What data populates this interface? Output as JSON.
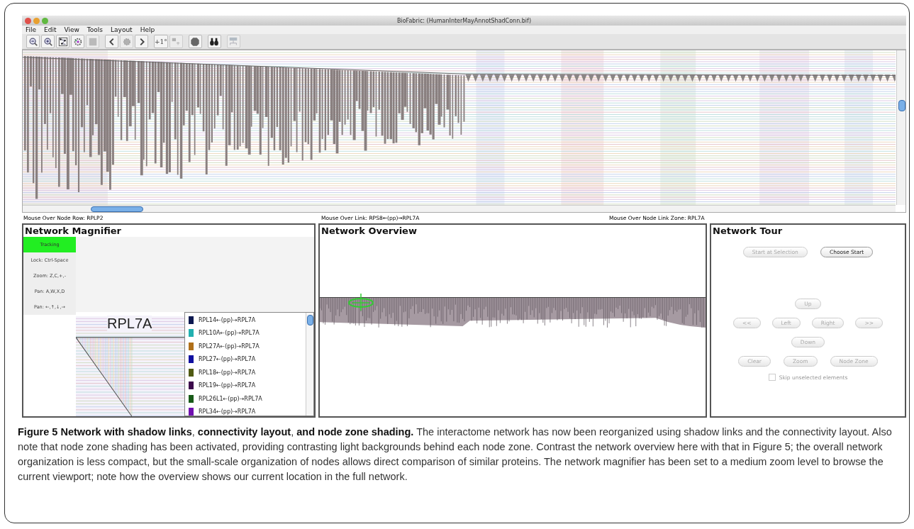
{
  "window": {
    "title": "BioFabric: (HumanInterMayAnnotShadConn.bif)"
  },
  "menu": [
    "File",
    "Edit",
    "View",
    "Tools",
    "Layout",
    "Help"
  ],
  "toolbar": [
    {
      "kind": "icon",
      "disabled": false
    },
    {
      "kind": "icon",
      "disabled": false
    },
    {
      "kind": "icon",
      "disabled": false
    },
    {
      "kind": "icon",
      "disabled": false
    },
    {
      "kind": "icon",
      "disabled": true
    },
    {
      "kind": "icon",
      "disabled": false
    },
    {
      "kind": "icon",
      "disabled": true
    },
    {
      "kind": "icon",
      "disabled": false
    },
    {
      "kind": "text",
      "label": "+1°",
      "disabled": false
    },
    {
      "kind": "icon",
      "disabled": true
    },
    {
      "kind": "icon",
      "disabled": false
    },
    {
      "kind": "icon",
      "disabled": false
    },
    {
      "kind": "icon",
      "disabled": true
    }
  ],
  "status_bar": [
    "Mouse Over Node Row: RPLP2",
    "Mouse Over Link: RPS8←(pp)→RPL7A",
    "Mouse Over Node Link Zone: RPL7A"
  ],
  "magnifier": {
    "title": "Network Magnifier",
    "controls": [
      {
        "label": "Tracking",
        "selected": true
      },
      {
        "label": "Lock: Ctrl-Space",
        "selected": false
      },
      {
        "label": "Zoom: Z,C,+,-",
        "selected": false
      },
      {
        "label": "Pan: A,W,X,D",
        "selected": false
      },
      {
        "label": "Pan: ←,↑,↓,→",
        "selected": false
      }
    ],
    "node_label": "RPL7A",
    "links": [
      {
        "label": "RPL14←(pp)→RPL7A",
        "color": "#0c1850"
      },
      {
        "label": "RPL10A←(pp)→RPL7A",
        "color": "#22b0b0"
      },
      {
        "label": "RPL27A←(pp)→RPL7A",
        "color": "#b0701a"
      },
      {
        "label": "RPL27←(pp)→RPL7A",
        "color": "#1010a0"
      },
      {
        "label": "RPL18←(pp)→RPL7A",
        "color": "#505a12"
      },
      {
        "label": "RPL19←(pp)→RPL7A",
        "color": "#3c0a4c"
      },
      {
        "label": "RPL26L1←(pp)→RPL7A",
        "color": "#185a18"
      },
      {
        "label": "RPL34←(pp)→RPL7A",
        "color": "#7010b0"
      }
    ]
  },
  "overview": {
    "title": "Network Overview"
  },
  "tour": {
    "title": "Network Tour",
    "rows": [
      [
        {
          "label": "Start at Selection",
          "disabled": true
        },
        {
          "label": "Choose Start",
          "disabled": false
        }
      ],
      [
        {
          "label": "Up",
          "disabled": true
        }
      ],
      [
        {
          "label": "<<",
          "disabled": true
        },
        {
          "label": "Left",
          "disabled": true
        },
        {
          "label": "Right",
          "disabled": true
        },
        {
          "label": ">>",
          "disabled": true
        }
      ],
      [
        {
          "label": "Down",
          "disabled": true
        }
      ],
      [
        {
          "label": "Clear",
          "disabled": true
        },
        {
          "label": "Zoom",
          "disabled": true
        },
        {
          "label": "Node Zone",
          "disabled": true
        }
      ]
    ],
    "checkbox": {
      "label": "Skip unselected elements",
      "checked": false,
      "disabled": true
    }
  },
  "caption": "**Figure 5 Network with shadow links**, **connectivity layout**, **and node zone shading.** The interactome network has now been reorganized using shadow links and the connectivity layout. Also note that node zone shading has been activated, providing contrasting light backgrounds behind each node zone. Contrast the network overview here with that in Figure 5; the overall network organization is less compact, but the small-scale organization of nodes allows direct comparison of similar proteins. The network magnifier has been set to a medium zoom level to browse the current viewport; note how the overview shows our current location in the full network."
}
